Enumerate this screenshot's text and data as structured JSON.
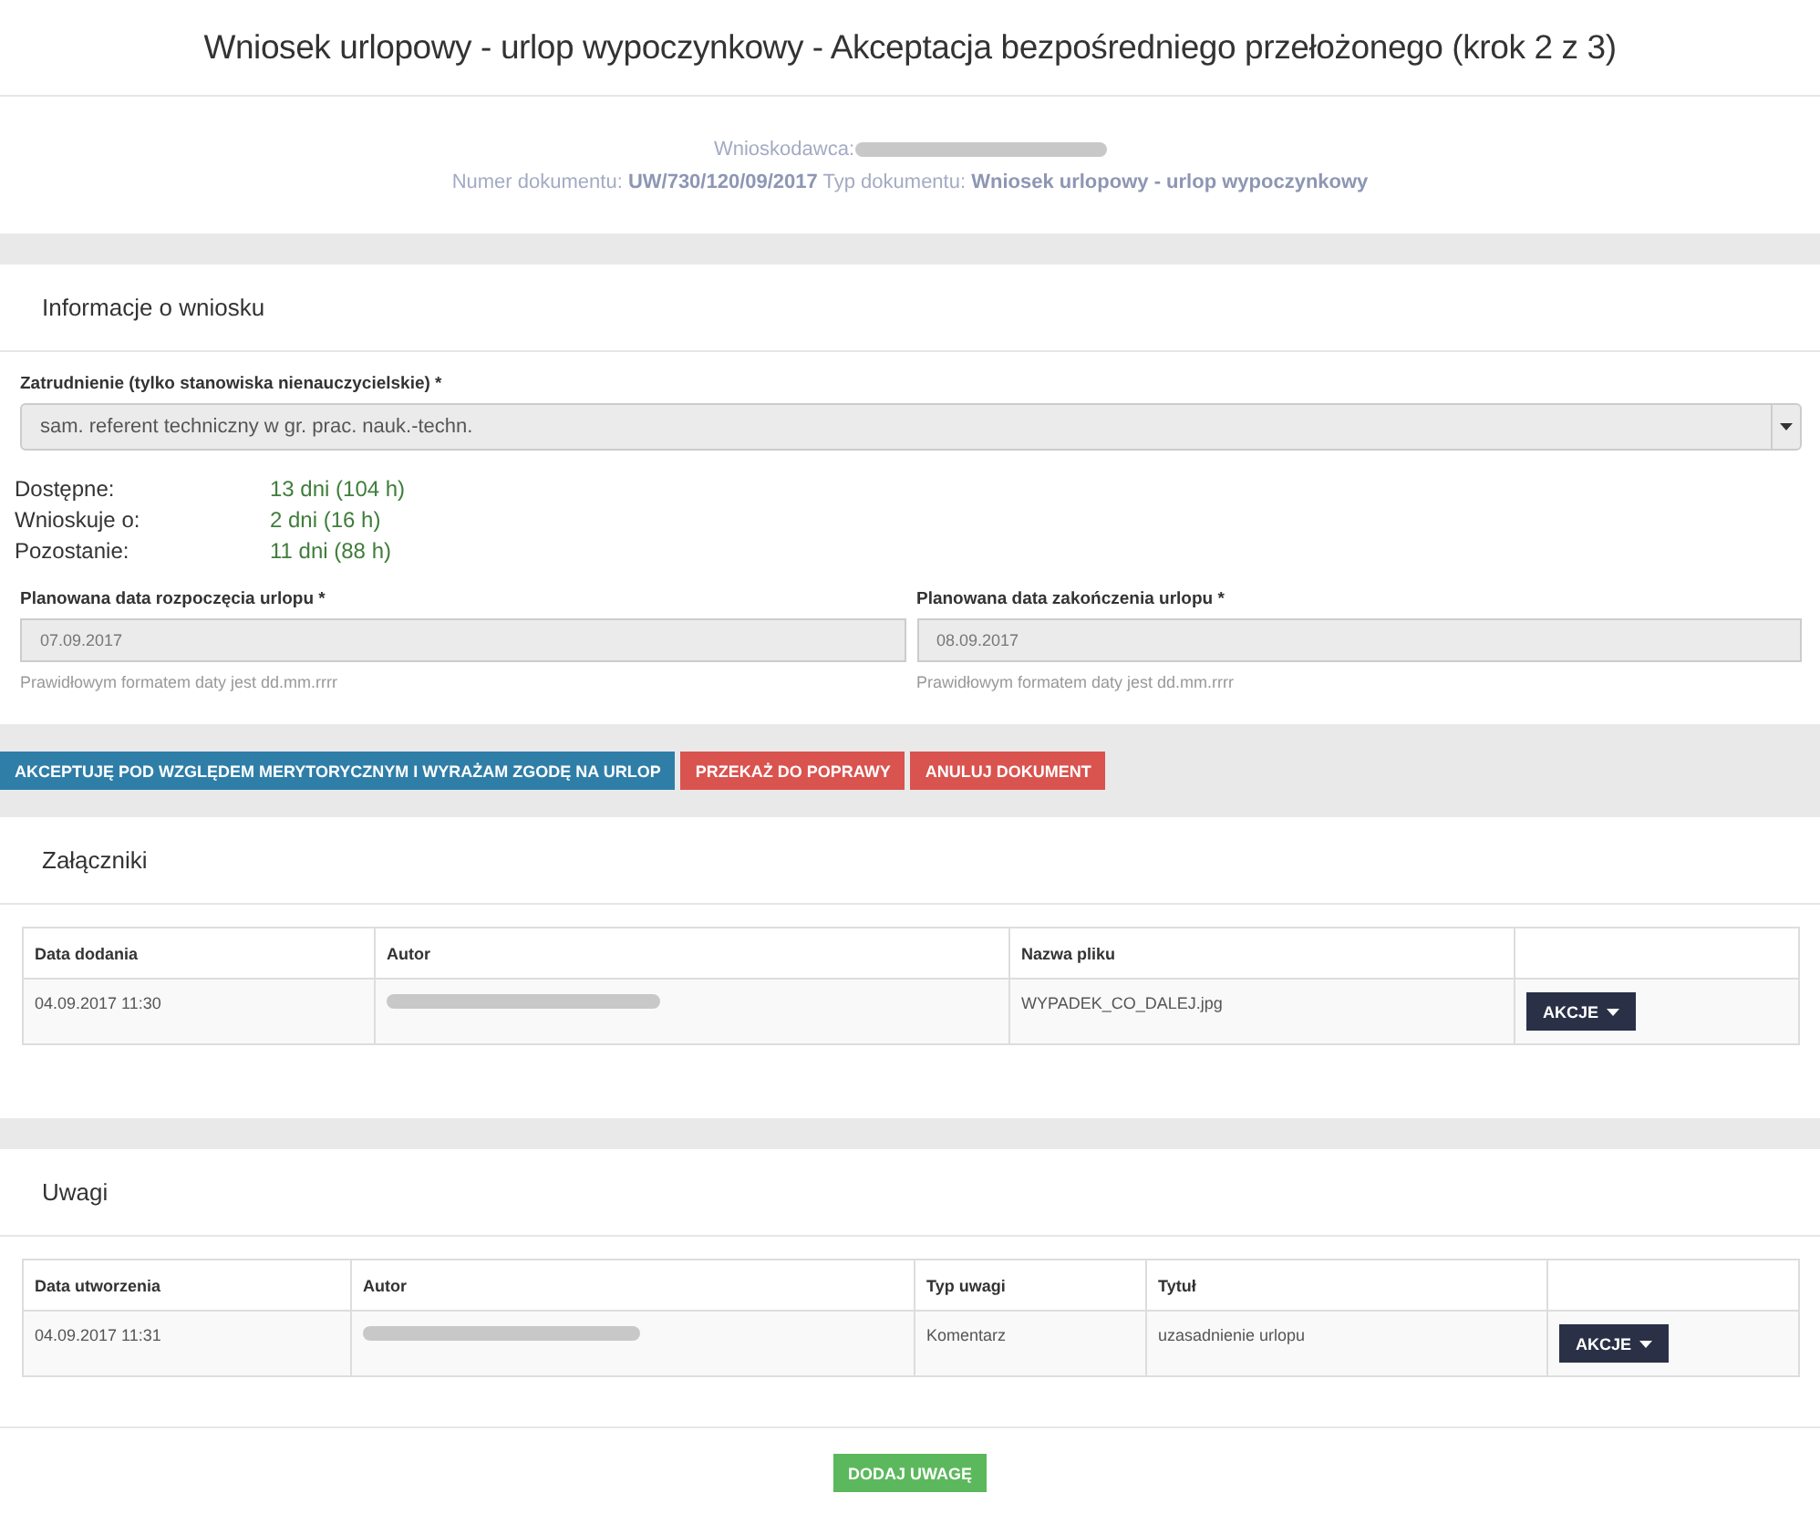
{
  "title": "Wniosek urlopowy - urlop wypoczynkowy - Akceptacja bezpośredniego przełożonego (krok 2 z 3)",
  "document": {
    "applicant_label": "Wnioskodawca:",
    "details": "Numer dokumentu: **UW/730/120/09/2017** Typ dokumentu: **Wniosek urlopowy - urlop wypoczynkowy**"
  },
  "info": {
    "heading": "Informacje o wniosku",
    "employment": {
      "label": "Zatrudnienie (tylko stanowiska nienauczycielskie) *",
      "value": "sam. referent techniczny w gr. prac. nauk.-techn.",
      "disabled": true
    },
    "stats": [
      {
        "label": "Dostępne:",
        "value": "13 dni (104 h)"
      },
      {
        "label": "Wnioskuje o:",
        "value": "2 dni (16 h)"
      },
      {
        "label": "Pozostanie:",
        "value": "11 dni (88 h)"
      }
    ],
    "dates": [
      {
        "label": "Planowana data rozpoczęcia urlopu *",
        "value": "07.09.2017",
        "hint": "Prawidłowym formatem daty jest dd.mm.rrrr"
      },
      {
        "label": "Planowana data zakończenia urlopu *",
        "value": "08.09.2017",
        "hint": "Prawidłowym formatem daty jest dd.mm.rrrr"
      }
    ]
  },
  "actions": [
    {
      "label": "AKCEPTUJĘ POD WZGLĘDEM MERYTORYCZNYM I WYRAŻAM ZGODĘ NA URLOP",
      "kind": "primary"
    },
    {
      "label": "PRZEKAŻ DO POPRAWY",
      "kind": "danger"
    },
    {
      "label": "ANULUJ DOKUMENT",
      "kind": "danger"
    }
  ],
  "attachments": {
    "heading": "Załączniki",
    "columns": [
      "Data dodania",
      "Autor",
      "Nazwa pliku"
    ],
    "rows": [
      {
        "date": "04.09.2017 11:30",
        "file": "WYPADEK_CO_DALEJ.jpg",
        "action": "AKCJE"
      }
    ]
  },
  "notes": {
    "heading": "Uwagi",
    "columns": [
      "Data utworzenia",
      "Autor",
      "Typ uwagi",
      "Tytuł"
    ],
    "rows": [
      {
        "date": "04.09.2017 11:31",
        "type": "Komentarz",
        "subject": "uzasadnienie urlopu",
        "action": "AKCJE"
      }
    ]
  },
  "add_note_button": "DODAJ UWAGĘ"
}
